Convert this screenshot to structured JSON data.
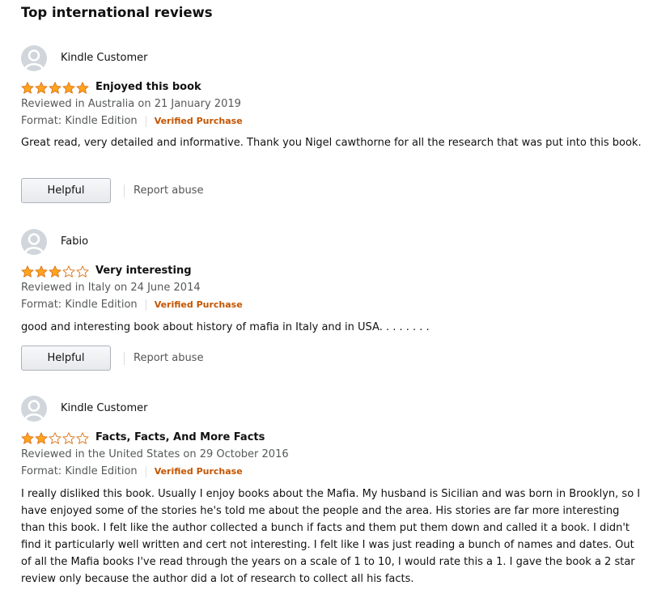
{
  "section_title": "Top international reviews",
  "colors": {
    "star": "#ffa41c",
    "star_outline": "#de7921",
    "verified": "#c45500"
  },
  "reviews": [
    {
      "profile_name": "Kindle Customer",
      "rating": 5,
      "title": "Enjoyed this book",
      "date": "Reviewed in Australia on 21 January 2019",
      "format": "Format: Kindle Edition",
      "verified": "Verified Purchase",
      "body": "Great read, very detailed and informative. Thank you Nigel cawthorne for all the research that was put into this book.",
      "helpful_label": "Helpful",
      "report_label": "Report abuse"
    },
    {
      "profile_name": "Fabio",
      "rating": 3,
      "title": "Very interesting",
      "date": "Reviewed in Italy on 24 June 2014",
      "format": "Format: Kindle Edition",
      "verified": "Verified Purchase",
      "body": "good and interesting book about history of mafia in Italy and in USA. . . . . . . .",
      "helpful_label": "Helpful",
      "report_label": "Report abuse"
    },
    {
      "profile_name": "Kindle Customer",
      "rating": 2,
      "title": "Facts, Facts, And More Facts",
      "date": "Reviewed in the United States on 29 October 2016",
      "format": "Format: Kindle Edition",
      "verified": "Verified Purchase",
      "body": "I really disliked this book. Usually I enjoy books about the Mafia. My husband is Sicilian and was born in Brooklyn, so I have enjoyed some of the stories he's told me about the people and the area. His stories are far more interesting than this book. I felt like the author collected a bunch if facts and them put them down and called it a book. I didn't find it particularly well written and cert not interesting. I felt like I was just reading a bunch of names and dates. Out of all the Mafia books I've read through the years on a scale of 1 to 10, I would rate this a 1. I gave the book a 2 star review only because the author did a lot of research to collect all his facts."
    }
  ]
}
